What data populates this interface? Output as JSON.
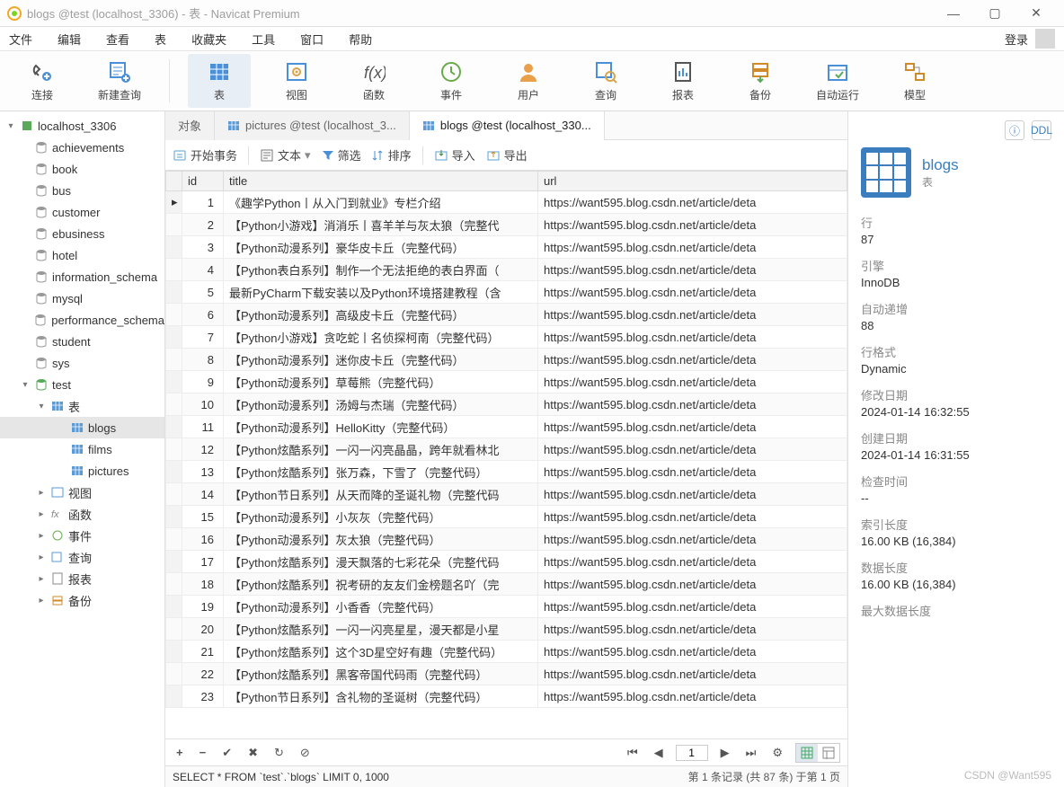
{
  "window_title": "blogs @test (localhost_3306) - 表 - Navicat Premium",
  "menu": [
    "文件",
    "编辑",
    "查看",
    "表",
    "收藏夹",
    "工具",
    "窗口",
    "帮助"
  ],
  "login_label": "登录",
  "toolbar": [
    {
      "label": "连接",
      "icon": "plug"
    },
    {
      "label": "新建查询",
      "icon": "newquery"
    },
    {
      "label": "表",
      "icon": "table",
      "active": true
    },
    {
      "label": "视图",
      "icon": "view"
    },
    {
      "label": "函数",
      "icon": "fx"
    },
    {
      "label": "事件",
      "icon": "clock"
    },
    {
      "label": "用户",
      "icon": "user"
    },
    {
      "label": "查询",
      "icon": "query"
    },
    {
      "label": "报表",
      "icon": "report"
    },
    {
      "label": "备份",
      "icon": "backup"
    },
    {
      "label": "自动运行",
      "icon": "auto"
    },
    {
      "label": "模型",
      "icon": "model"
    }
  ],
  "tree": {
    "conn": "localhost_3306",
    "dbs": [
      "achievements",
      "book",
      "bus",
      "customer",
      "ebusiness",
      "hotel",
      "information_schema",
      "mysql",
      "performance_schema",
      "student",
      "sys"
    ],
    "open_db": "test",
    "tables_label": "表",
    "tables": [
      "blogs",
      "films",
      "pictures"
    ],
    "other_nodes": [
      "视图",
      "函数",
      "事件",
      "查询",
      "报表",
      "备份"
    ]
  },
  "tabs": [
    {
      "label": "对象",
      "icon": "none"
    },
    {
      "label": "pictures @test (localhost_3...",
      "icon": "table"
    },
    {
      "label": "blogs @test (localhost_330...",
      "icon": "table",
      "active": true
    }
  ],
  "subtoolbar": {
    "begin_tx": "开始事务",
    "text": "文本",
    "filter": "筛选",
    "sort": "排序",
    "import": "导入",
    "export": "导出"
  },
  "grid": {
    "columns": [
      "id",
      "title",
      "url"
    ],
    "rows": [
      {
        "id": 1,
        "title": "《趣学Python丨从入门到就业》专栏介绍",
        "url": "https://want595.blog.csdn.net/article/deta"
      },
      {
        "id": 2,
        "title": "【Python小游戏】消消乐丨喜羊羊与灰太狼（完整代",
        "url": "https://want595.blog.csdn.net/article/deta"
      },
      {
        "id": 3,
        "title": "【Python动漫系列】豪华皮卡丘（完整代码）",
        "url": "https://want595.blog.csdn.net/article/deta"
      },
      {
        "id": 4,
        "title": "【Python表白系列】制作一个无法拒绝的表白界面（",
        "url": "https://want595.blog.csdn.net/article/deta"
      },
      {
        "id": 5,
        "title": "最新PyCharm下载安装以及Python环境搭建教程（含",
        "url": "https://want595.blog.csdn.net/article/deta"
      },
      {
        "id": 6,
        "title": "【Python动漫系列】高级皮卡丘（完整代码）",
        "url": "https://want595.blog.csdn.net/article/deta"
      },
      {
        "id": 7,
        "title": "【Python小游戏】贪吃蛇丨名侦探柯南（完整代码）",
        "url": "https://want595.blog.csdn.net/article/deta"
      },
      {
        "id": 8,
        "title": "【Python动漫系列】迷你皮卡丘（完整代码）",
        "url": "https://want595.blog.csdn.net/article/deta"
      },
      {
        "id": 9,
        "title": "【Python动漫系列】草莓熊（完整代码）",
        "url": "https://want595.blog.csdn.net/article/deta"
      },
      {
        "id": 10,
        "title": "【Python动漫系列】汤姆与杰瑞（完整代码）",
        "url": "https://want595.blog.csdn.net/article/deta"
      },
      {
        "id": 11,
        "title": "【Python动漫系列】HelloKitty（完整代码）",
        "url": "https://want595.blog.csdn.net/article/deta"
      },
      {
        "id": 12,
        "title": "【Python炫酷系列】一闪一闪亮晶晶，跨年就看林北",
        "url": "https://want595.blog.csdn.net/article/deta"
      },
      {
        "id": 13,
        "title": "【Python炫酷系列】张万森，下雪了（完整代码）",
        "url": "https://want595.blog.csdn.net/article/deta"
      },
      {
        "id": 14,
        "title": "【Python节日系列】从天而降的圣诞礼物（完整代码",
        "url": "https://want595.blog.csdn.net/article/deta"
      },
      {
        "id": 15,
        "title": "【Python动漫系列】小灰灰（完整代码）",
        "url": "https://want595.blog.csdn.net/article/deta"
      },
      {
        "id": 16,
        "title": "【Python动漫系列】灰太狼（完整代码）",
        "url": "https://want595.blog.csdn.net/article/deta"
      },
      {
        "id": 17,
        "title": "【Python炫酷系列】漫天飘落的七彩花朵（完整代码",
        "url": "https://want595.blog.csdn.net/article/deta"
      },
      {
        "id": 18,
        "title": "【Python炫酷系列】祝考研的友友们金榜题名吖（完",
        "url": "https://want595.blog.csdn.net/article/deta"
      },
      {
        "id": 19,
        "title": "【Python动漫系列】小香香（完整代码）",
        "url": "https://want595.blog.csdn.net/article/deta"
      },
      {
        "id": 20,
        "title": "【Python炫酷系列】一闪一闪亮星星，漫天都是小星",
        "url": "https://want595.blog.csdn.net/article/deta"
      },
      {
        "id": 21,
        "title": "【Python炫酷系列】这个3D星空好有趣（完整代码）",
        "url": "https://want595.blog.csdn.net/article/deta"
      },
      {
        "id": 22,
        "title": "【Python炫酷系列】黑客帝国代码雨（完整代码）",
        "url": "https://want595.blog.csdn.net/article/deta"
      },
      {
        "id": 23,
        "title": "【Python节日系列】含礼物的圣诞树（完整代码）",
        "url": "https://want595.blog.csdn.net/article/deta"
      }
    ]
  },
  "pager": {
    "page": "1"
  },
  "sql": "SELECT * FROM `test`.`blogs` LIMIT 0, 1000",
  "status_right": "第 1 条记录 (共 87 条) 于第 1 页",
  "props": {
    "title": "blogs",
    "sub": "表",
    "items": [
      {
        "k": "行",
        "v": "87"
      },
      {
        "k": "引擎",
        "v": "InnoDB"
      },
      {
        "k": "自动递增",
        "v": "88"
      },
      {
        "k": "行格式",
        "v": "Dynamic"
      },
      {
        "k": "修改日期",
        "v": "2024-01-14 16:32:55"
      },
      {
        "k": "创建日期",
        "v": "2024-01-14 16:31:55"
      },
      {
        "k": "检查时间",
        "v": "--"
      },
      {
        "k": "索引长度",
        "v": "16.00 KB (16,384)"
      },
      {
        "k": "数据长度",
        "v": "16.00 KB (16,384)"
      },
      {
        "k": "最大数据长度",
        "v": ""
      }
    ]
  },
  "watermark": "CSDN @Want595"
}
